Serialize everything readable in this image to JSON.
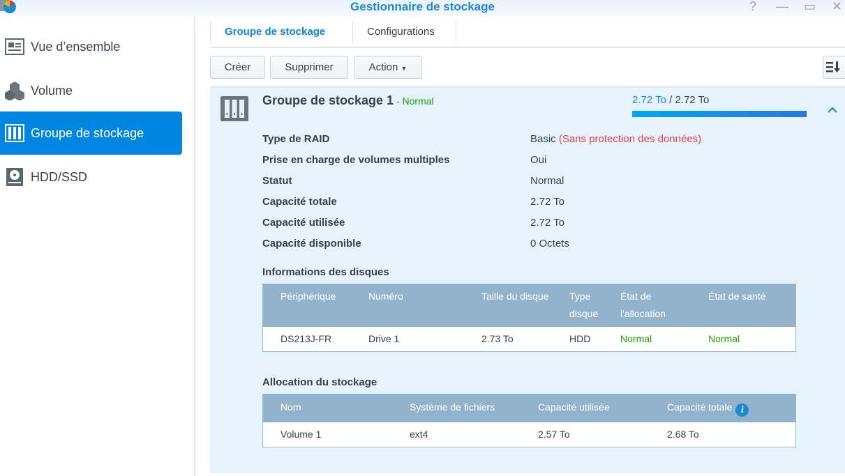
{
  "window": {
    "title": "Gestionnaire de stockage",
    "help": "?",
    "minimize": "—",
    "maximize": "▭",
    "close": "✕"
  },
  "sidebar": {
    "items": [
      {
        "label": "Vue d’ensemble"
      },
      {
        "label": "Volume"
      },
      {
        "label": "Groupe de stockage"
      },
      {
        "label": "HDD/SSD"
      }
    ]
  },
  "tabs": [
    {
      "label": "Groupe de stockage"
    },
    {
      "label": "Configurations"
    }
  ],
  "toolbar": {
    "create": "Créer",
    "delete": "Supprimer",
    "action": "Action"
  },
  "group": {
    "name": "Groupe de stockage 1",
    "sep": " - ",
    "status": "Normal",
    "used": "2.72 To",
    "slash": " / ",
    "total": "2.72 To",
    "usage_fraction": 1.0,
    "colors": {
      "accent": "#0086e0",
      "green": "#1fa000",
      "red": "#e83c3c"
    },
    "props": [
      {
        "label": "Type de RAID",
        "value": "Basic",
        "extra": "(Sans protection des données)"
      },
      {
        "label": "Prise en charge de volumes multiples",
        "value": "Oui"
      },
      {
        "label": "Statut",
        "value": "Normal"
      },
      {
        "label": "Capacité totale",
        "value": "2.72 To"
      },
      {
        "label": "Capacité utilisée",
        "value": "2.72 To"
      },
      {
        "label": "Capacité disponible",
        "value": "0 Octets"
      }
    ]
  },
  "disks": {
    "title": "Informations des disques",
    "headers": [
      "Périphérique",
      "Numéro",
      "Taille du disque",
      "Type disque",
      "État de l'allocation",
      "État de santé"
    ],
    "rows": [
      [
        "DS213J-FR",
        "Drive 1",
        "2.73 To",
        "HDD",
        "Normal",
        "Normal"
      ]
    ]
  },
  "allocation": {
    "title": "Allocation du stockage",
    "headers": [
      "Nom",
      "Système de fichiers",
      "Capacité utilisée",
      "Capacité totale"
    ],
    "rows": [
      [
        "Volume 1",
        "ext4",
        "2.57 To",
        "2.68 To"
      ]
    ]
  }
}
